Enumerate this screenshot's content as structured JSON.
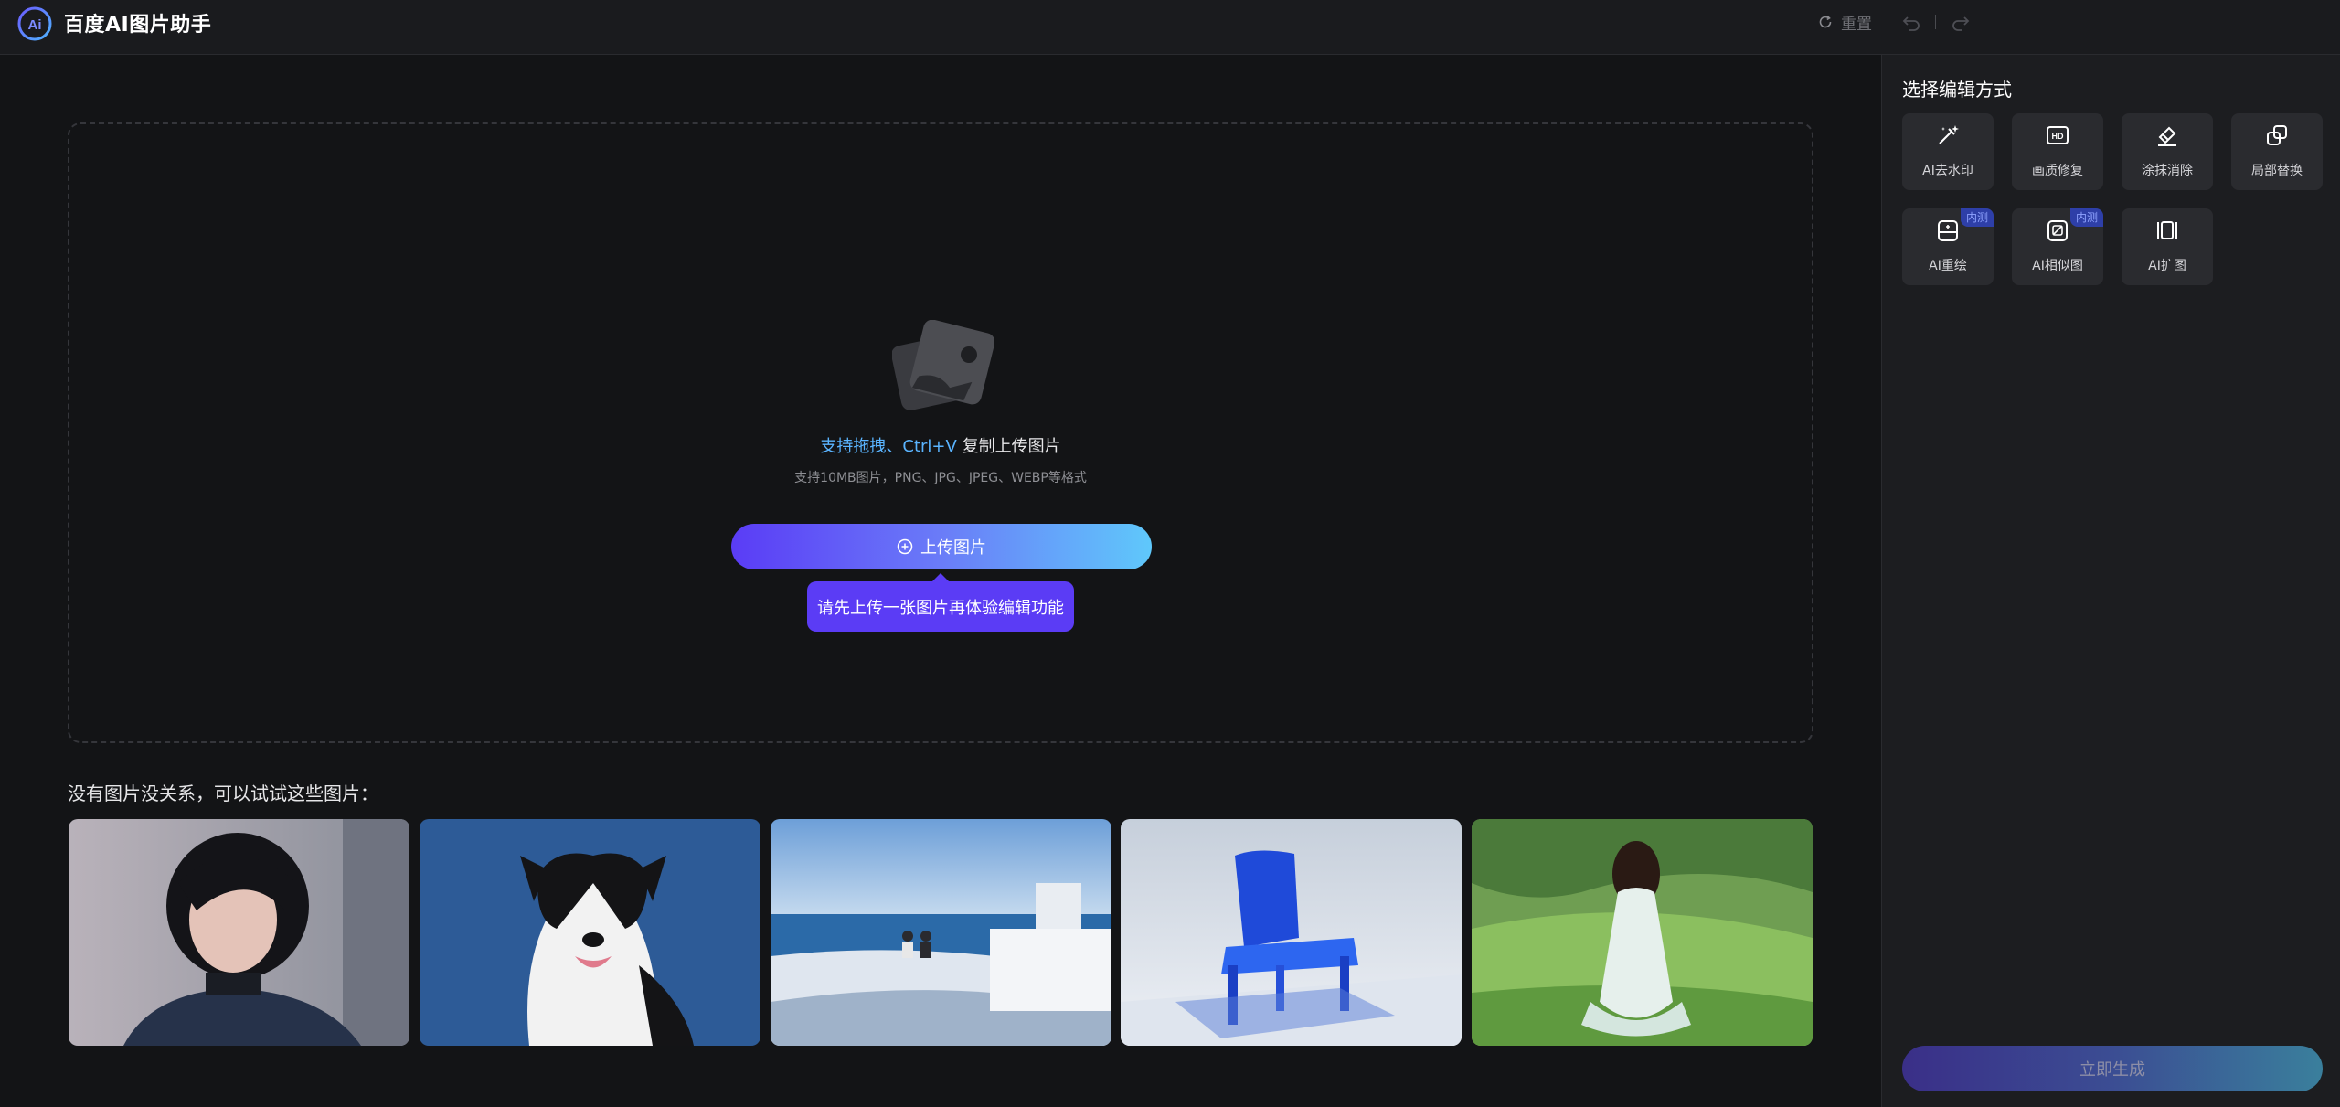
{
  "header": {
    "title": "百度AI图片助手",
    "reset_label": "重置"
  },
  "upload": {
    "hint_highlight": "支持拖拽、Ctrl+V",
    "hint_normal": " 复制上传图片",
    "formats": "支持10MB图片，PNG、JPG、JPEG、WEBP等格式",
    "button_label": "上传图片",
    "tooltip": "请先上传一张图片再体验编辑功能"
  },
  "samples": {
    "title": "没有图片没关系，可以试试这些图片：",
    "items": [
      {
        "icon": "portrait-image"
      },
      {
        "icon": "dog-image"
      },
      {
        "icon": "seaside-image"
      },
      {
        "icon": "blue-chair-image"
      },
      {
        "icon": "meadow-girl-image"
      }
    ]
  },
  "panel": {
    "title": "选择编辑方式",
    "tools": [
      {
        "label": "AI去水印",
        "icon": "magic-wand-icon",
        "badge": ""
      },
      {
        "label": "画质修复",
        "icon": "hd-icon",
        "badge": ""
      },
      {
        "label": "涂抹消除",
        "icon": "eraser-icon",
        "badge": ""
      },
      {
        "label": "局部替换",
        "icon": "replace-icon",
        "badge": ""
      },
      {
        "label": "AI重绘",
        "icon": "redraw-icon",
        "badge": "内测"
      },
      {
        "label": "AI相似图",
        "icon": "similar-image-icon",
        "badge": "内测"
      },
      {
        "label": "AI扩图",
        "icon": "expand-icon",
        "badge": ""
      }
    ],
    "generate_label": "立即生成"
  },
  "colors": {
    "accent_purple": "#5b3cf5",
    "accent_blue": "#5ab4ff",
    "background": "#131416",
    "panel": "#1c1d20"
  }
}
